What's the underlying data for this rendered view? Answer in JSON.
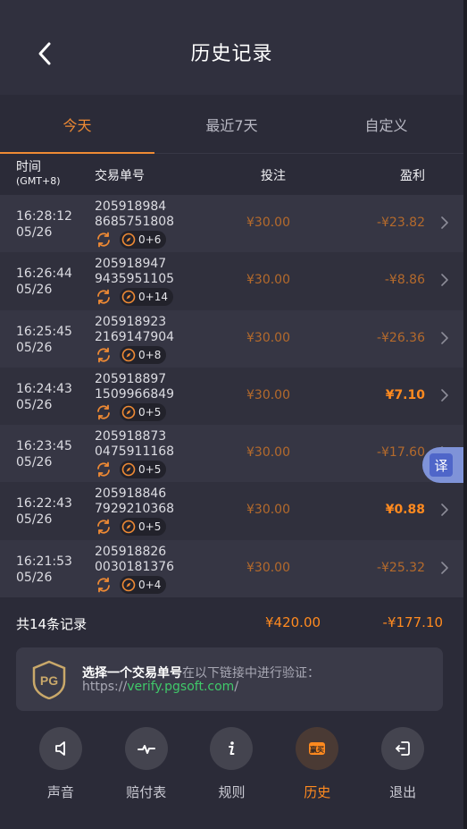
{
  "header": {
    "title": "历史记录"
  },
  "tabs": [
    {
      "label": "今天",
      "active": true
    },
    {
      "label": "最近7天",
      "active": false
    },
    {
      "label": "自定义",
      "active": false
    }
  ],
  "columns": {
    "time": "时间",
    "time_sub": "(GMT+8)",
    "order": "交易单号",
    "bet": "投注",
    "profit": "盈利"
  },
  "rows": [
    {
      "time": "16:28:12",
      "date": "05/26",
      "order1": "205918984",
      "order2": "8685751808",
      "combo": "0+6",
      "bet": "¥30.00",
      "profit": "-¥23.82",
      "positive": false
    },
    {
      "time": "16:26:44",
      "date": "05/26",
      "order1": "205918947",
      "order2": "9435951105",
      "combo": "0+14",
      "bet": "¥30.00",
      "profit": "-¥8.86",
      "positive": false
    },
    {
      "time": "16:25:45",
      "date": "05/26",
      "order1": "205918923",
      "order2": "2169147904",
      "combo": "0+8",
      "bet": "¥30.00",
      "profit": "-¥26.36",
      "positive": false
    },
    {
      "time": "16:24:43",
      "date": "05/26",
      "order1": "205918897",
      "order2": "1509966849",
      "combo": "0+5",
      "bet": "¥30.00",
      "profit": "¥7.10",
      "positive": true
    },
    {
      "time": "16:23:45",
      "date": "05/26",
      "order1": "205918873",
      "order2": "0475911168",
      "combo": "0+5",
      "bet": "¥30.00",
      "profit": "-¥17.60",
      "positive": false
    },
    {
      "time": "16:22:43",
      "date": "05/26",
      "order1": "205918846",
      "order2": "7929210368",
      "combo": "0+5",
      "bet": "¥30.00",
      "profit": "¥0.88",
      "positive": true
    },
    {
      "time": "16:21:53",
      "date": "05/26",
      "order1": "205918826",
      "order2": "0030181376",
      "combo": "0+4",
      "bet": "¥30.00",
      "profit": "-¥25.32",
      "positive": false
    }
  ],
  "total": {
    "label": "共14条记录",
    "bet": "¥420.00",
    "profit": "-¥177.10"
  },
  "verify": {
    "logo_text": "PG",
    "strong": "选择一个交易单号",
    "rest": "在以下链接中进行验证：",
    "prefix": "https://",
    "link": "verify.pgsoft.com",
    "suffix": "/"
  },
  "nav": [
    {
      "label": "声音",
      "icon": "speaker-icon",
      "active": false
    },
    {
      "label": "赔付表",
      "icon": "pulse-icon",
      "active": false
    },
    {
      "label": "规则",
      "icon": "info-icon",
      "active": false
    },
    {
      "label": "历史",
      "icon": "history-icon",
      "badge": "赢买",
      "active": true
    },
    {
      "label": "退出",
      "icon": "exit-icon",
      "active": false
    }
  ],
  "translate": {
    "label": "译"
  },
  "colors": {
    "accent": "#ff8a1f",
    "link": "#40c96a",
    "background": "#2b2b38"
  }
}
